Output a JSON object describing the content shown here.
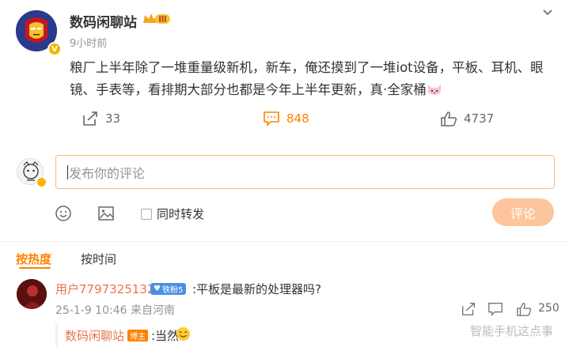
{
  "post": {
    "author": "数码闲聊站",
    "level_badge": "Ⅲ",
    "time": "9小时前",
    "text": "粮厂上半年除了一堆重量级新机，新车，俺还摸到了一堆iot设备，平板、耳机、眼镜、手表等，看排期大部分也都是今年上半年更新，真·全家桶",
    "reposts": "33",
    "comments": "848",
    "likes": "4737"
  },
  "composer": {
    "placeholder": "发布你的评论",
    "repost_label": "同时转发",
    "submit_label": "评论"
  },
  "sort_tabs": {
    "hot": "按热度",
    "time": "按时间"
  },
  "comment": {
    "user": "用户7797325132",
    "fan_badge": "铁粉5",
    "text": ":平板是最新的处理器吗?",
    "meta": "25-1-9 10:46 来自河南",
    "likes": "250"
  },
  "reply": {
    "user": "数码闲聊站",
    "badge": "博主",
    "text": ":当然"
  },
  "watermark": "智能手机这点事",
  "colors": {
    "accent": "#ff8200",
    "username": "#eb7350",
    "submit_disabled": "#fdc59b"
  }
}
